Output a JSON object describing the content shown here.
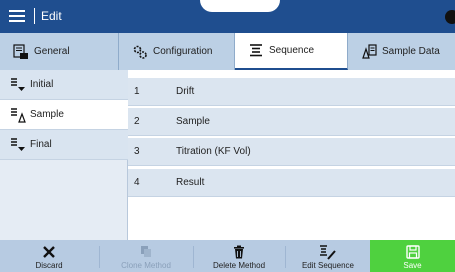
{
  "header": {
    "title": "Edit"
  },
  "tabs": [
    {
      "label": "General"
    },
    {
      "label": "Configuration"
    },
    {
      "label": "Sequence"
    },
    {
      "label": "Sample Data"
    }
  ],
  "left_items": [
    {
      "label": "Initial"
    },
    {
      "label": "Sample"
    },
    {
      "label": "Final"
    }
  ],
  "sequence_rows": [
    {
      "num": "1",
      "label": "Drift"
    },
    {
      "num": "2",
      "label": "Sample"
    },
    {
      "num": "3",
      "label": "Titration (KF Vol)"
    },
    {
      "num": "4",
      "label": "Result"
    }
  ],
  "bottom": {
    "discard": "Discard",
    "clone": "Clone Method",
    "delete": "Delete Method",
    "edit": "Edit Sequence",
    "save": "Save"
  },
  "colors": {
    "header_blue": "#1f4e8f",
    "tab_bg": "#bcd0e5",
    "save_green": "#4fd13f"
  }
}
